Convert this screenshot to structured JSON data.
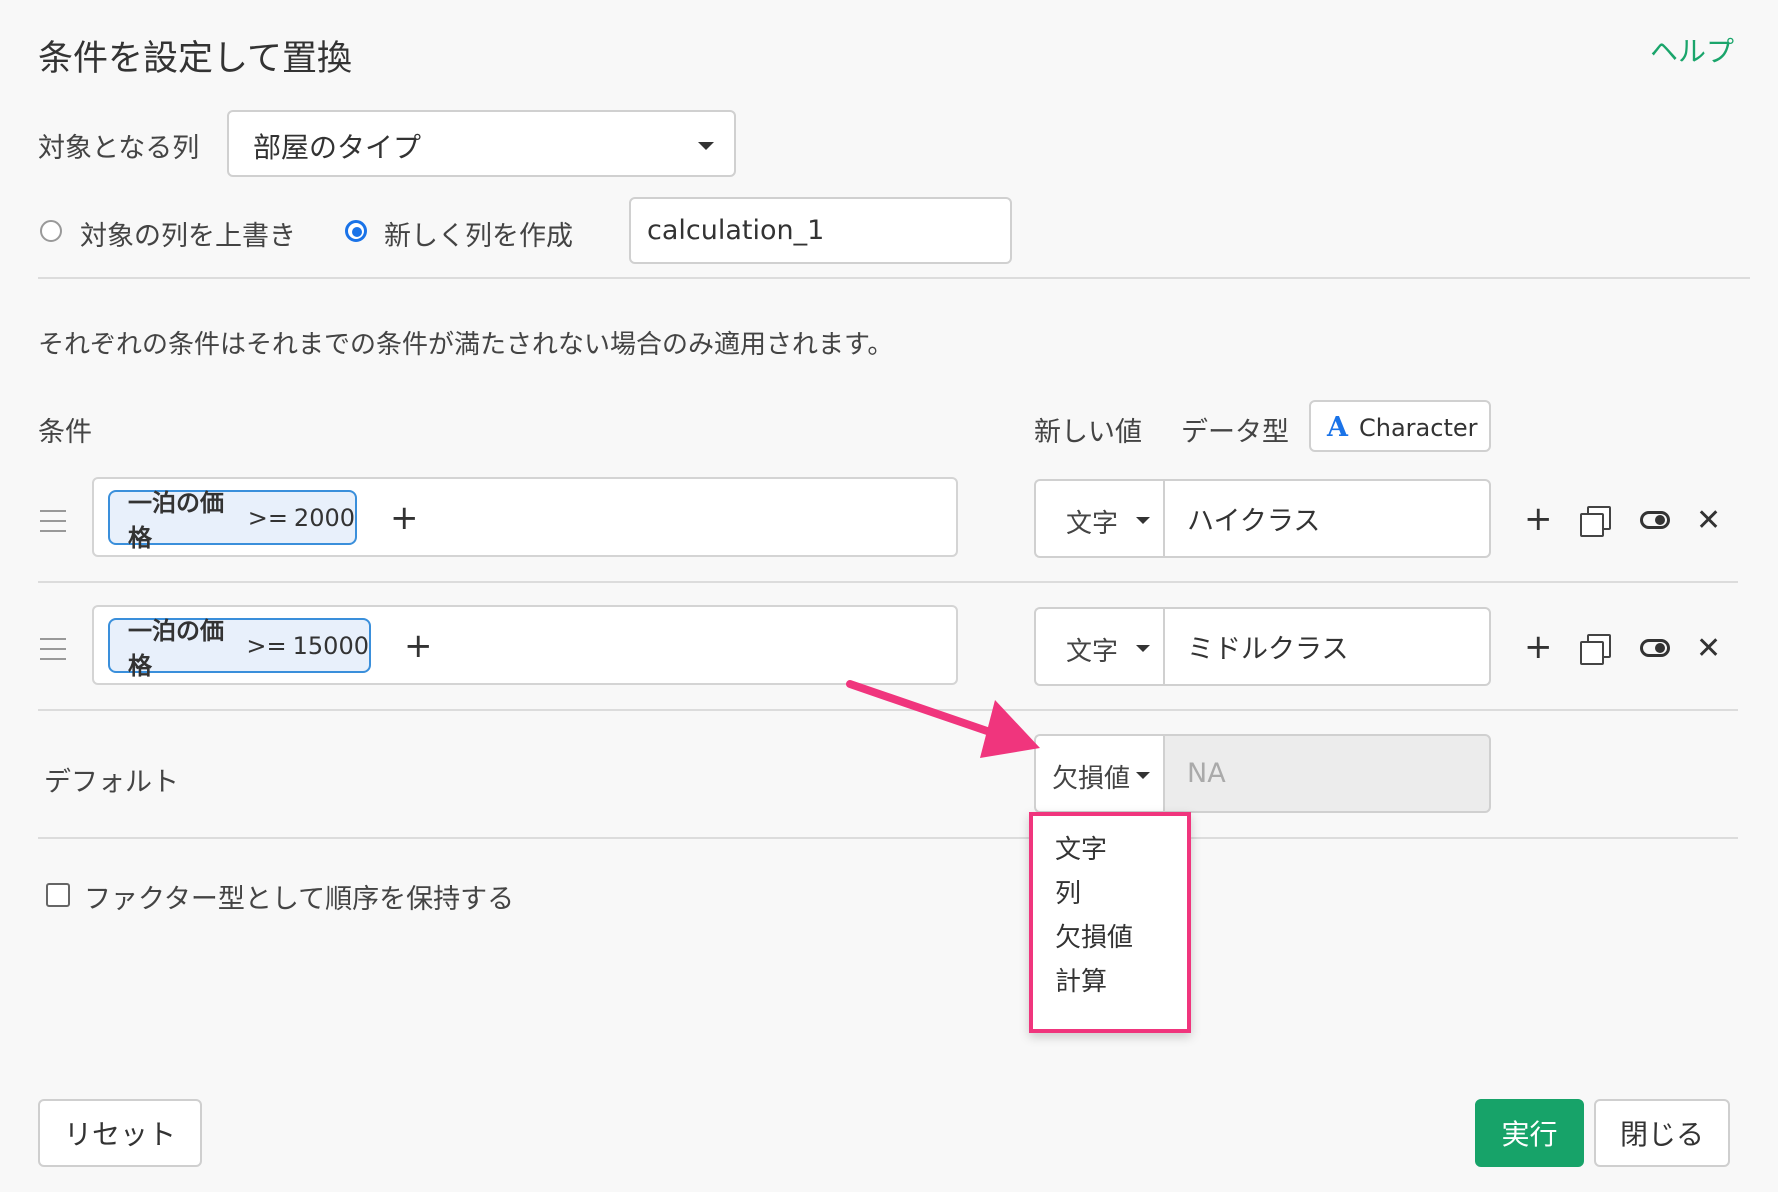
{
  "header": {
    "title": "条件を設定して置換",
    "help_label": "ヘルプ"
  },
  "target_column": {
    "label": "対象となる列",
    "value": "部屋のタイプ"
  },
  "output_mode": {
    "overwrite_label": "対象の列を上書き",
    "new_column_label": "新しく列を作成",
    "selected": "new_column",
    "new_column_name": "calculation_1"
  },
  "description": "それぞれの条件はそれまでの条件が満たされない場合のみ適用されます。",
  "headers": {
    "condition": "条件",
    "new_value": "新しい値",
    "data_type": "データ型"
  },
  "data_type": {
    "icon": "A",
    "label": "Character",
    "icon_color": "#1a73e8"
  },
  "rules": [
    {
      "condition_column": "一泊の価格",
      "operator": ">=",
      "condition_value": "2000",
      "type": "文字",
      "value": "ハイクラス"
    },
    {
      "condition_column": "一泊の価格",
      "operator": ">=",
      "condition_value": "15000",
      "type": "文字",
      "value": "ミドルクラス"
    }
  ],
  "default_row": {
    "label": "デフォルト",
    "type": "欠損値",
    "value": "NA"
  },
  "type_dropdown": {
    "options": [
      "文字",
      "列",
      "欠損値",
      "計算"
    ]
  },
  "factor_option": {
    "label": "ファクター型として順序を保持する",
    "checked": false
  },
  "footer": {
    "reset_label": "リセット",
    "run_label": "実行",
    "close_label": "閉じる"
  },
  "colors": {
    "accent_green": "#17a369",
    "link_green": "#1aa56b",
    "chip_border": "#3a8fdb",
    "highlight_pink": "#f0357d"
  }
}
